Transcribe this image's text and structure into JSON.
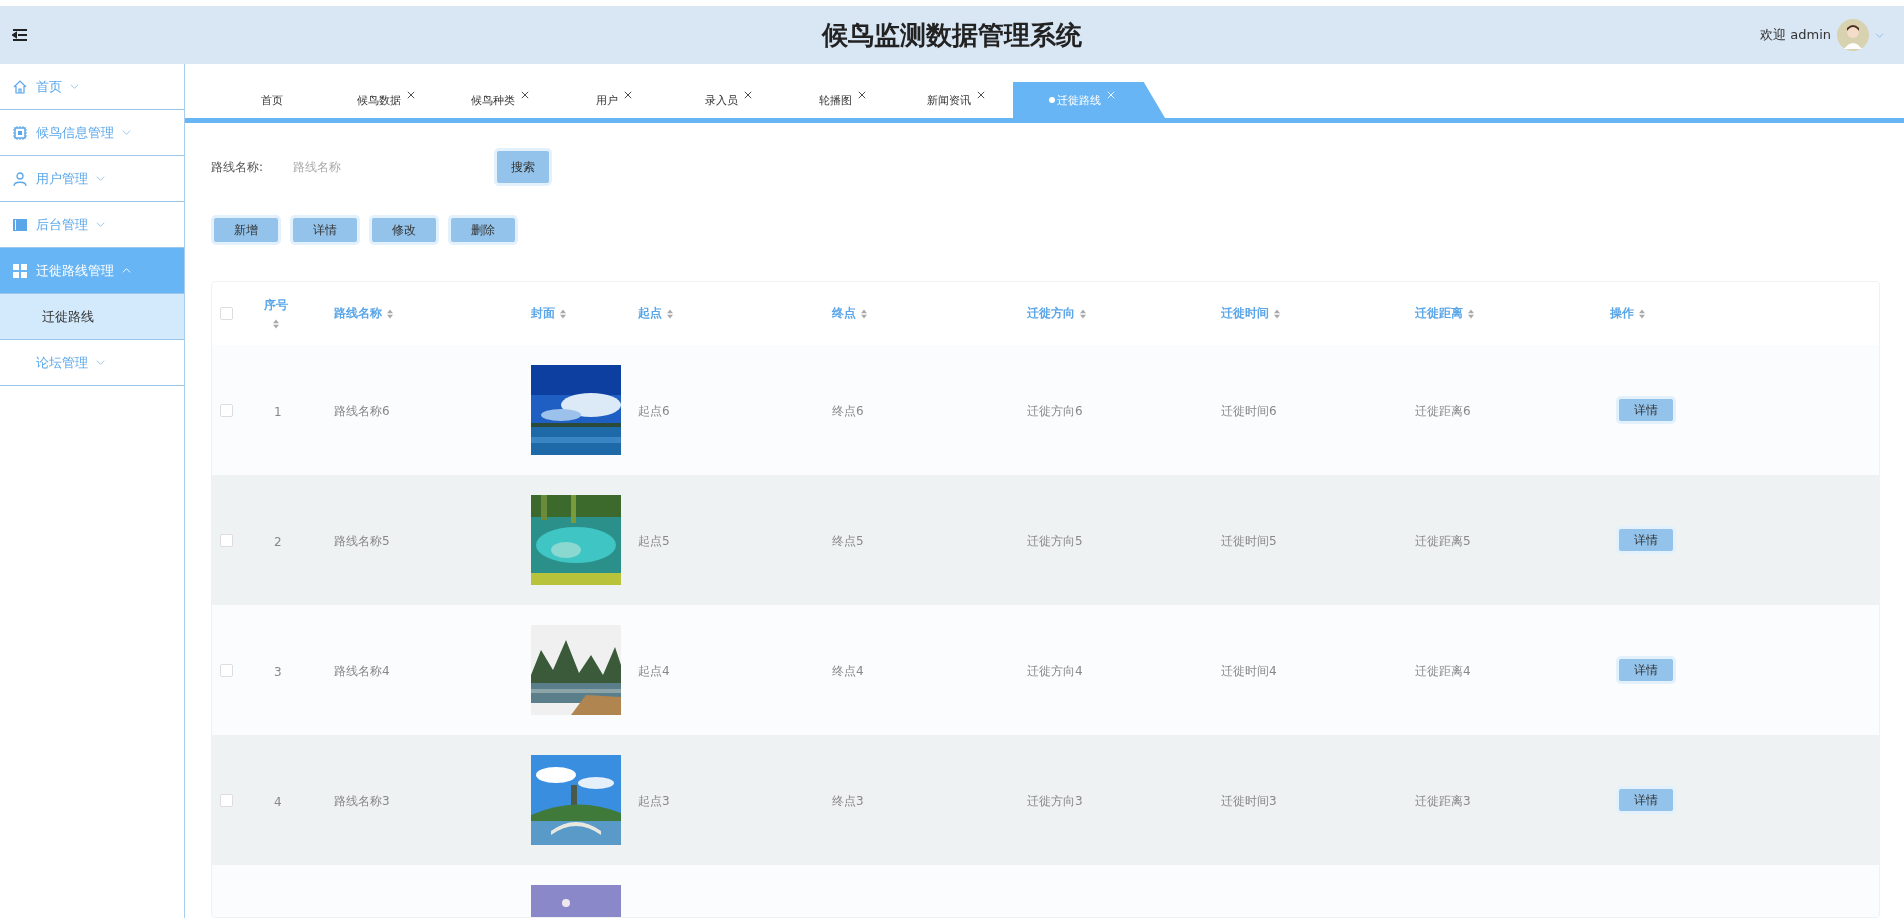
{
  "header": {
    "title": "候鸟监测数据管理系统",
    "greeting": "欢迎 admin"
  },
  "sidebar": {
    "items": [
      {
        "label": "首页",
        "kind": "home",
        "expanded": false,
        "selected": false
      },
      {
        "label": "候鸟信息管理",
        "kind": "chip",
        "expanded": false,
        "selected": false
      },
      {
        "label": "用户管理",
        "kind": "user",
        "expanded": false,
        "selected": false
      },
      {
        "label": "后台管理",
        "kind": "panel",
        "expanded": false,
        "selected": false
      },
      {
        "label": "迁徙路线管理",
        "kind": "grid",
        "expanded": true,
        "selected": true,
        "children": [
          {
            "label": "迁徙路线",
            "selected": true
          }
        ]
      },
      {
        "label": "论坛管理",
        "kind": "plain",
        "expanded": false,
        "selected": false
      }
    ]
  },
  "tabs": [
    {
      "label": "首页",
      "closable": false,
      "selected": false
    },
    {
      "label": "候鸟数据",
      "closable": true,
      "selected": false
    },
    {
      "label": "候鸟种类",
      "closable": true,
      "selected": false
    },
    {
      "label": "用户",
      "closable": true,
      "selected": false
    },
    {
      "label": "录入员",
      "closable": true,
      "selected": false
    },
    {
      "label": "轮播图",
      "closable": true,
      "selected": false
    },
    {
      "label": "新闻资讯",
      "closable": true,
      "selected": false
    },
    {
      "label": "迁徙路线",
      "closable": true,
      "selected": true
    }
  ],
  "search": {
    "label": "路线名称:",
    "placeholder": "路线名称",
    "button": "搜索"
  },
  "actions": [
    "新增",
    "详情",
    "修改",
    "删除"
  ],
  "table": {
    "header_checked": false,
    "columns": [
      {
        "label": "序号"
      },
      {
        "label": "路线名称"
      },
      {
        "label": "封面"
      },
      {
        "label": "起点"
      },
      {
        "label": "终点"
      },
      {
        "label": "迁徙方向"
      },
      {
        "label": "迁徙时间"
      },
      {
        "label": "迁徙距离"
      },
      {
        "label": "操作"
      }
    ],
    "rows": [
      {
        "checked": false,
        "index": "1",
        "name": "路线名称6",
        "cover": {
          "kind": "picture"
        },
        "start": "起点6",
        "end": "终点6",
        "direction": "迁徙方向6",
        "time": "迁徙时间6",
        "distance": "迁徙距离6",
        "action": "详情"
      },
      {
        "checked": false,
        "index": "2",
        "name": "路线名称5",
        "cover": {
          "kind": "picture"
        },
        "start": "起点5",
        "end": "终点5",
        "direction": "迁徙方向5",
        "time": "迁徙时间5",
        "distance": "迁徙距离5",
        "action": "详情"
      },
      {
        "checked": false,
        "index": "3",
        "name": "路线名称4",
        "cover": {
          "kind": "picture"
        },
        "start": "起点4",
        "end": "终点4",
        "direction": "迁徙方向4",
        "time": "迁徙时间4",
        "distance": "迁徙距离4",
        "action": "详情"
      },
      {
        "checked": false,
        "index": "4",
        "name": "路线名称3",
        "cover": {
          "kind": "picture"
        },
        "start": "起点3",
        "end": "终点3",
        "direction": "迁徙方向3",
        "time": "迁徙时间3",
        "distance": "迁徙距离3",
        "action": "详情"
      },
      {
        "cover": {
          "kind": "picture"
        }
      }
    ]
  }
}
